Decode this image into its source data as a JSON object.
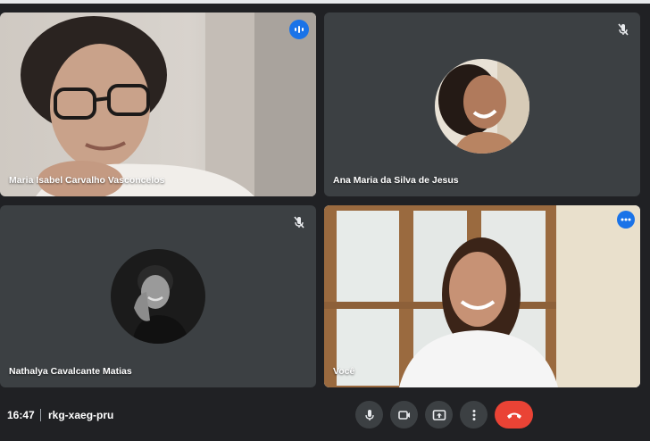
{
  "meeting": {
    "time": "16:47",
    "code": "rkg-xaeg-pru"
  },
  "participants": [
    {
      "name": "Maria Isabel Carvalho Vasconcelos",
      "status": "speaking",
      "video": true
    },
    {
      "name": "Ana Maria da Silva de Jesus",
      "status": "muted",
      "video": false
    },
    {
      "name": "Nathalya Cavalcante Matias",
      "status": "muted",
      "video": false
    },
    {
      "name": "Você",
      "status": "self",
      "video": true
    }
  ],
  "controls": [
    "mic-icon",
    "camera-icon",
    "present-icon",
    "more-options-icon",
    "end-call-icon"
  ],
  "colors": {
    "background": "#202124",
    "tile": "#3c4043",
    "accent": "#1a73e8",
    "end_call": "#ea4335",
    "self_border": "#8ab4f8"
  }
}
